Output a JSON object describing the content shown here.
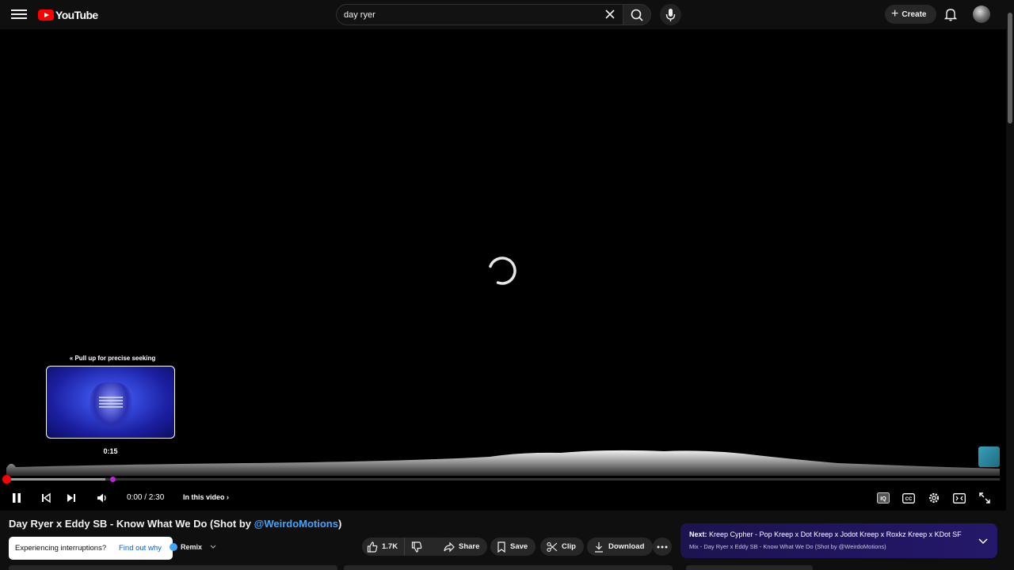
{
  "header": {
    "logo_text": "YouTube",
    "search": {
      "value": "day ryer",
      "placeholder": "Search"
    },
    "create_label": "Create"
  },
  "player": {
    "pull_hint": "Pull up for precise seeking",
    "preview_time": "0:15",
    "current_time": "0:00 / 2:30",
    "in_this_video": "In this video",
    "progress_played_fraction": 0.0,
    "hover_fraction": 0.1
  },
  "video": {
    "title_prefix": "Day Ryer x Eddy SB - Know What We Do (Shot by ",
    "title_handle": "@WeirdoMotions",
    "title_suffix": ")"
  },
  "toast": {
    "message": "Experiencing interruptions?",
    "action": "Find out why"
  },
  "actions": {
    "remix_label": "Remix",
    "like_count": "1.7K",
    "share_label": "Share",
    "save_label": "Save",
    "clip_label": "Clip",
    "download_label": "Download"
  },
  "up_next": {
    "prefix": "Next:",
    "title": "Kreep Cypher - Pop Kreep x Dot Kreep x Jodot Kreep x Roxkz Kreep x KDot SF",
    "subtitle": "Mix - Day Ryer x Eddy SB - Know What We Do (Shot by @WeirdoMotions)"
  },
  "colors": {
    "accent": "#ff0000",
    "link": "#3ea6ff",
    "upnext_bg": "#1e1552"
  }
}
